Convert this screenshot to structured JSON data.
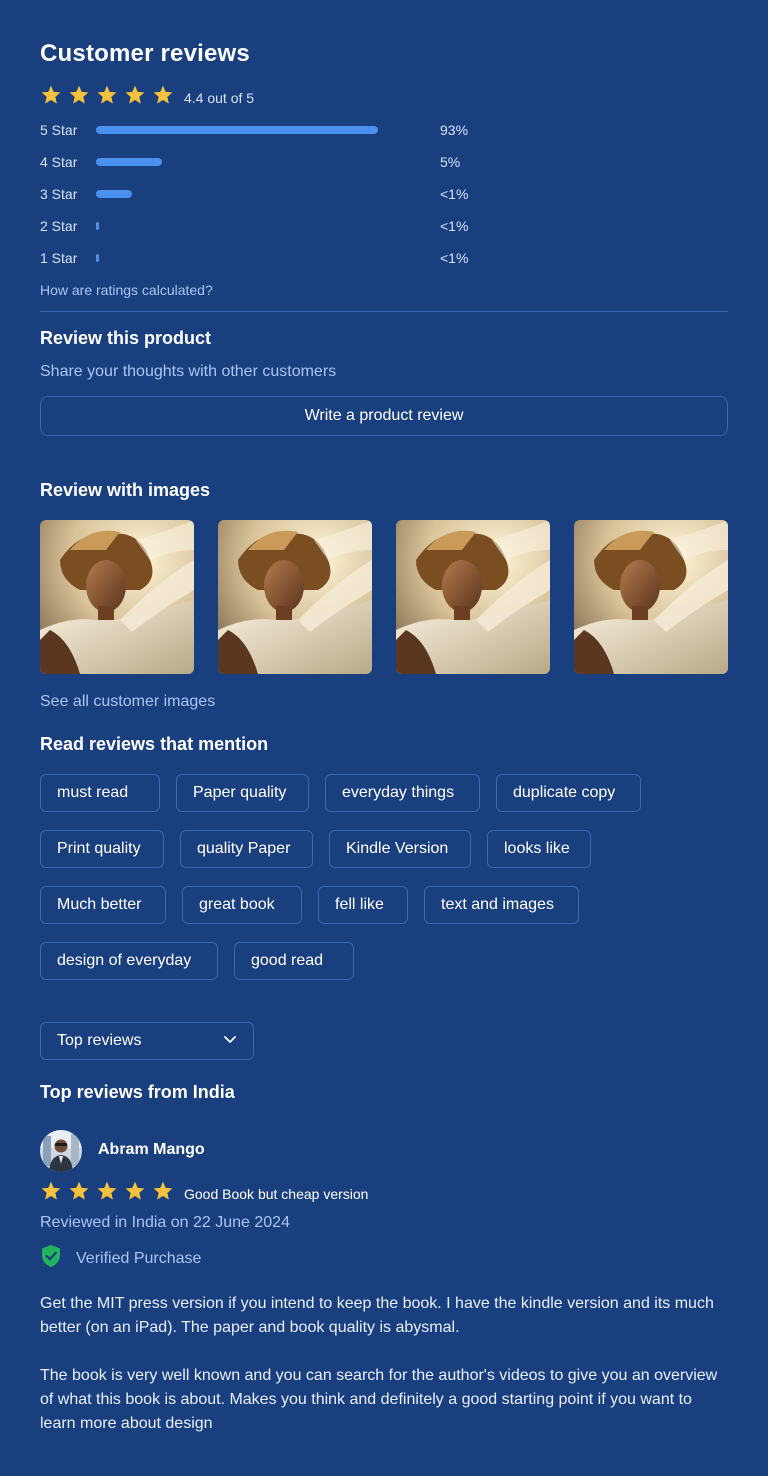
{
  "header": {
    "title": "Customer reviews",
    "rating_text": "4.4 out of 5",
    "rating_value": 4.4,
    "stars_filled": 5
  },
  "histogram": [
    {
      "label": "5 Star",
      "percent_text": "93%",
      "fill_fraction": 0.94
    },
    {
      "label": "4 Star",
      "percent_text": "5%",
      "fill_fraction": 0.22
    },
    {
      "label": "3 Star",
      "percent_text": "<1%",
      "fill_fraction": 0.12
    },
    {
      "label": "2 Star",
      "percent_text": "<1%",
      "fill_fraction": 0.01
    },
    {
      "label": "1 Star",
      "percent_text": "<1%",
      "fill_fraction": 0.01
    }
  ],
  "ratings_link": "How are ratings calculated?",
  "review_product": {
    "title": "Review this product",
    "subtitle": "Share your thoughts with other customers",
    "button_label": "Write a product review"
  },
  "review_images": {
    "title": "Review with images",
    "count": 4,
    "see_all": "See all customer images"
  },
  "mentions": {
    "title": "Read reviews that mention",
    "chips": [
      "must read",
      "Paper quality",
      "everyday things",
      "duplicate copy",
      "Print quality",
      "quality Paper",
      "Kindle Version",
      "looks like",
      "Much better",
      "great book",
      "fell like",
      "text and images",
      "design of everyday",
      "good read"
    ]
  },
  "sort": {
    "selected": "Top reviews",
    "icon": "chevron-down-icon"
  },
  "top_reviews": {
    "title": "Top reviews from India",
    "review": {
      "author": "Abram Mango",
      "stars": 5,
      "headline": "Good Book but cheap version",
      "date_line": "Reviewed in India on 22 June 2024",
      "verified": "Verified Purchase",
      "paragraph_1": "Get the MIT press version if you intend to keep the book. I have the kindle version and its much better (on an iPad). The paper and book quality is abysmal.",
      "paragraph_2": "The book is very well known and you can search for the author's videos to give you an overview of what this book is about. Makes you think and definitely a good starting point if you want to learn more about design"
    }
  },
  "colors": {
    "background": "#1a3f7f",
    "bar": "#4a90ee",
    "star": "#f7c23b",
    "link": "#a9c6f2",
    "verified": "#22b35e",
    "border": "#3a66ae"
  }
}
